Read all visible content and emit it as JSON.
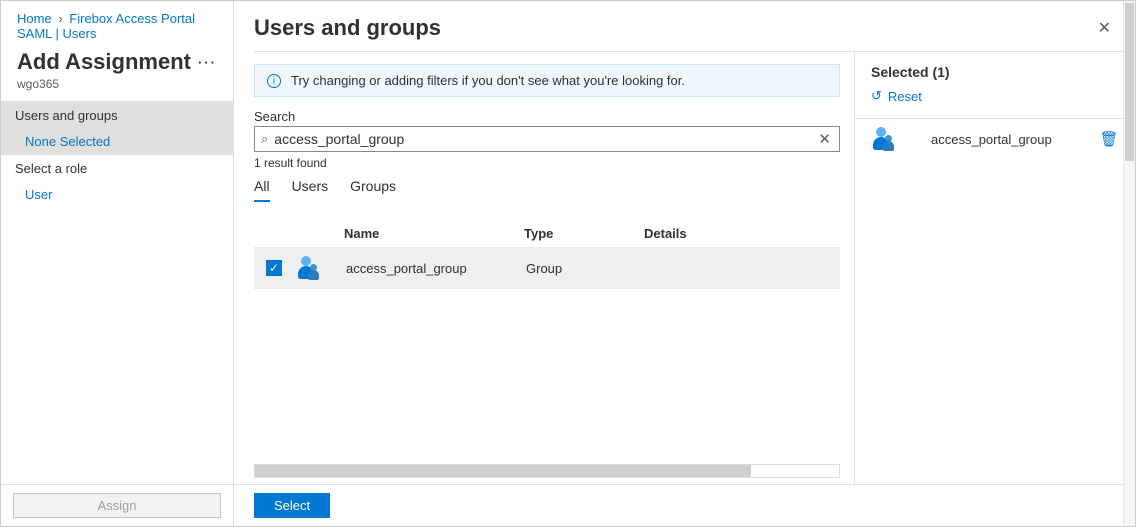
{
  "breadcrumb": {
    "home": "Home",
    "item": "Firebox Access Portal SAML | Users"
  },
  "left": {
    "title": "Add Assignment",
    "subtitle": "wgo365",
    "ellipsis": "···",
    "section1": "Users and groups",
    "section1_value": "None Selected",
    "section2": "Select a role",
    "section2_value": "User",
    "assign_btn": "Assign"
  },
  "blade": {
    "title": "Users and groups",
    "info": "Try changing or adding filters if you don't see what you're looking for.",
    "search_label": "Search",
    "search_value": "access_portal_group",
    "result_count": "1 result found",
    "tabs": {
      "all": "All",
      "users": "Users",
      "groups": "Groups"
    },
    "headers": {
      "name": "Name",
      "type": "Type",
      "details": "Details"
    },
    "rows": [
      {
        "name": "access_portal_group",
        "type": "Group",
        "details": ""
      }
    ],
    "select_btn": "Select"
  },
  "selected": {
    "header_prefix": "Selected",
    "count": "(1)",
    "reset": "Reset",
    "items": [
      {
        "name": "access_portal_group"
      }
    ]
  }
}
